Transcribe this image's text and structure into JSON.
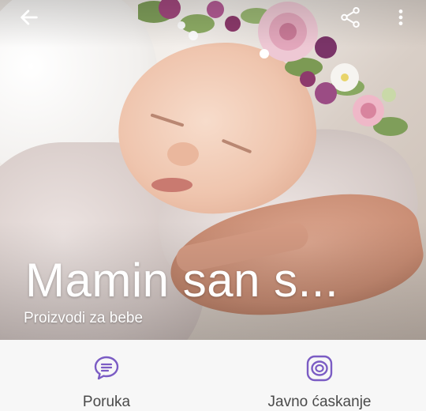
{
  "header": {
    "back_icon": "arrow-left-icon",
    "share_icon": "share-icon",
    "more_icon": "more-vertical-icon"
  },
  "profile": {
    "title": "Mamin san s...",
    "subtitle": "Proizvodi za bebe",
    "cover_image": "sleeping-baby-with-flower-wreath"
  },
  "actions": [
    {
      "label": "Poruka",
      "icon": "message-bubble-icon"
    },
    {
      "label": "Javno ćaskanje",
      "icon": "public-chat-icon"
    }
  ],
  "colors": {
    "accent": "#7b5cc4",
    "action_bar_bg": "#f7f7f7",
    "label_text": "#4a4a4a",
    "overlay_text": "#ffffff"
  }
}
